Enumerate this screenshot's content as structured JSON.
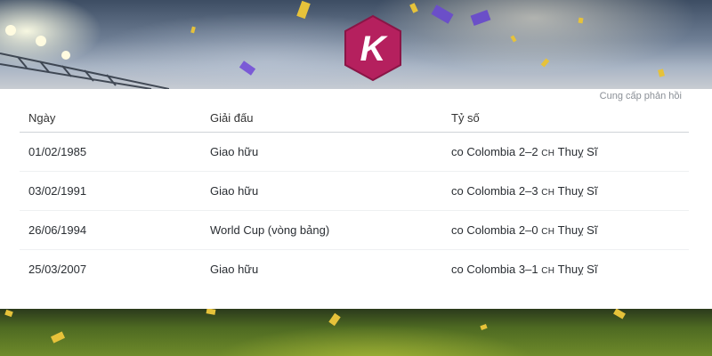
{
  "logo": {
    "letter": "K",
    "color": "#b5205e"
  },
  "feedback": {
    "label": "Cung cấp phản hồi"
  },
  "table": {
    "headers": {
      "date": "Ngày",
      "competition": "Giải đấu",
      "score": "Tỷ số"
    },
    "rows": [
      {
        "date": "01/02/1985",
        "competition": "Giao hữu",
        "home_flag": "co",
        "home": "Colombia",
        "score": "2–2",
        "away_flag": "ch",
        "away": "Thuỵ Sĩ"
      },
      {
        "date": "03/02/1991",
        "competition": "Giao hữu",
        "home_flag": "co",
        "home": "Colombia",
        "score": "2–3",
        "away_flag": "ch",
        "away": "Thuỵ Sĩ"
      },
      {
        "date": "26/06/1994",
        "competition": "World Cup (vòng bảng)",
        "home_flag": "co",
        "home": "Colombia",
        "score": "2–0",
        "away_flag": "ch",
        "away": "Thuỵ Sĩ"
      },
      {
        "date": "25/03/2007",
        "competition": "Giao hữu",
        "home_flag": "co",
        "home": "Colombia",
        "score": "3–1",
        "away_flag": "ch",
        "away": "Thuỵ Sĩ"
      }
    ]
  }
}
